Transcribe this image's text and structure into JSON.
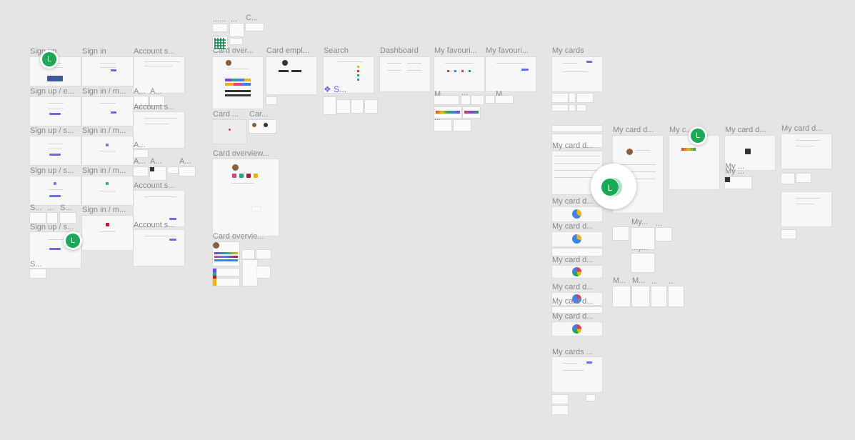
{
  "labels": {
    "col1": [
      "Sign up",
      "Sign up / e...",
      "Sign up / s...",
      "Sign up / s...",
      "S...",
      "...",
      "S...",
      "Sign up / s...",
      "S..."
    ],
    "col2": [
      "Sign in",
      "Sign in / m...",
      "Sign in / m...",
      "Sign in / m...",
      "Sign in / m..."
    ],
    "col3": [
      "Account s...",
      "A...",
      "A...",
      "Account s...",
      "A...",
      "A...",
      "A...",
      "A...",
      "Account s...",
      "Account s..."
    ],
    "col4": [
      "......",
      "...",
      "C...",
      "...",
      "Card over...",
      "Card empl...",
      "Card ...",
      "Car...",
      "Card overview...",
      "Card overvie..."
    ],
    "col5": [
      "Search",
      "Dashboard",
      "My favouri...",
      "My favouri...",
      "M...",
      "M...",
      "...",
      "...",
      "...",
      "..."
    ],
    "selected_frame": "S...",
    "col6": [
      "My cards",
      "My card d...",
      "My card d...",
      "My card d...",
      "My card d...",
      "My card d...",
      "My card d...",
      "My card d...",
      "My card d...",
      "My cards ..."
    ],
    "col7": [
      "My card d...",
      "My c...",
      "My card d...",
      "My card d...",
      "My ...",
      "My ...",
      "My...",
      "My...",
      "...",
      "M...",
      "M...",
      "...",
      "..."
    ]
  },
  "collaborators": [
    {
      "initial": "L",
      "color": "#1aaa55"
    },
    {
      "initial": "L",
      "color": "#1aaa55"
    },
    {
      "initial": "L",
      "color": "#1aaa55"
    },
    {
      "initial": "L",
      "color": "#1aaa55"
    }
  ],
  "colors": {
    "canvas_bg": "#e5e5e5",
    "frame_bg": "#f7f7f7",
    "label": "#8a8a8a",
    "accent": "#6b6bf0",
    "selection": "#7c5cf0",
    "avatar": "#1aaa55"
  }
}
